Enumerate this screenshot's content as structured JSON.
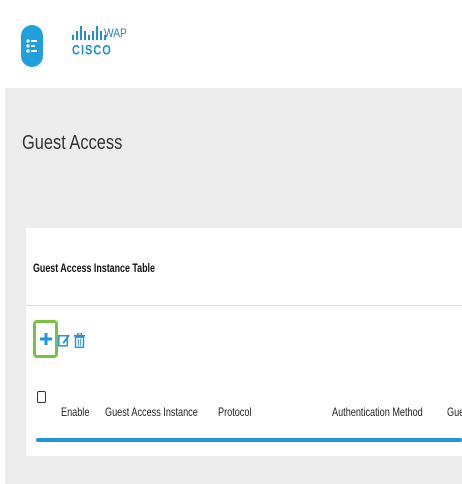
{
  "header": {
    "brand_wordmark": "CISCO",
    "app_name": "WAP"
  },
  "page": {
    "title": "Guest Access"
  },
  "table": {
    "title": "Guest Access Instance Table",
    "toolbar": {
      "add_icon": "plus-icon",
      "edit_icon": "edit-icon",
      "delete_icon": "trash-icon"
    },
    "columns": [
      "Enable",
      "Guest Access Instance",
      "Protocol",
      "Authentication Method",
      "Gue"
    ],
    "rows": []
  },
  "colors": {
    "accent_blue": "#1fa0dc",
    "highlight_green": "#79c143",
    "table_rule": "#1f97d6"
  }
}
